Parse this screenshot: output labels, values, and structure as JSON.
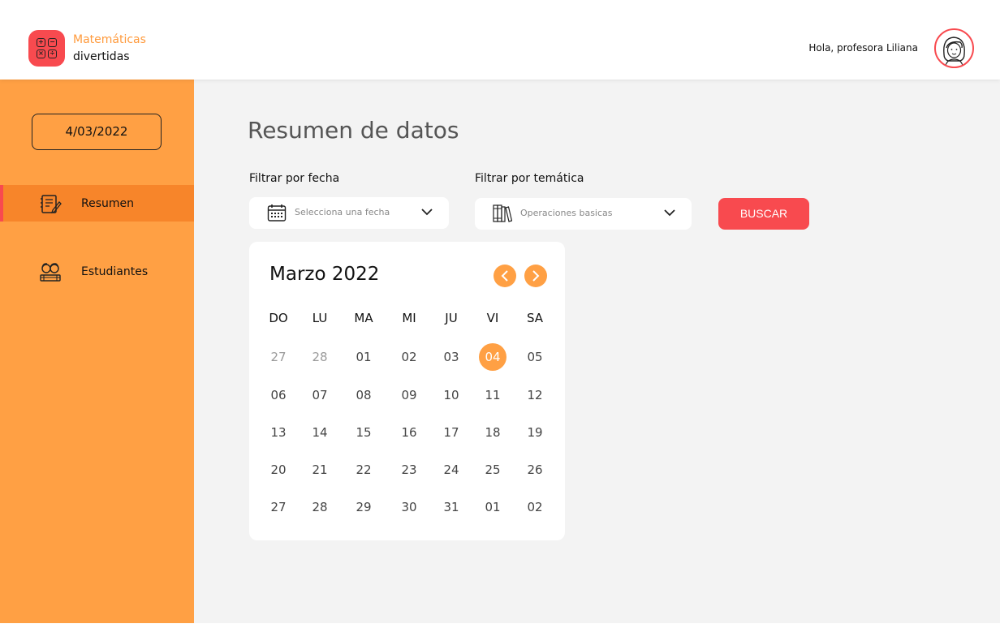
{
  "header": {
    "brand_line1": "Matemáticas",
    "brand_line2": "divertidas",
    "greeting": "Hola, profesora Liliana",
    "logo_icon": "calculator-icon",
    "avatar_icon": "teacher-avatar"
  },
  "sidebar": {
    "date": "4/03/2022",
    "items": [
      {
        "label": "Resumen",
        "icon": "notebook-pencil-icon",
        "active": true
      },
      {
        "label": "Estudiantes",
        "icon": "students-icon",
        "active": false
      }
    ]
  },
  "main": {
    "title": "Resumen de datos",
    "date_filter": {
      "label": "Filtrar por fecha",
      "placeholder": "Selecciona una fecha",
      "icon": "calendar-icon"
    },
    "topic_filter": {
      "label": "Filtrar por temática",
      "value": "Operaciones basicas",
      "icon": "books-icon"
    },
    "search_button": "BUSCAR"
  },
  "calendar": {
    "title": "Marzo 2022",
    "weekdays": [
      "DO",
      "LU",
      "MA",
      "MI",
      "JU",
      "VI",
      "SA"
    ],
    "weeks": [
      [
        "27",
        "28",
        "01",
        "02",
        "03",
        "04",
        "05"
      ],
      [
        "06",
        "07",
        "08",
        "09",
        "10",
        "11",
        "12"
      ],
      [
        "13",
        "14",
        "15",
        "16",
        "17",
        "18",
        "19"
      ],
      [
        "20",
        "21",
        "22",
        "23",
        "24",
        "25",
        "26"
      ],
      [
        "27",
        "28",
        "29",
        "30",
        "31",
        "01",
        "02"
      ]
    ],
    "muted_first_week_indices": [
      0,
      1
    ],
    "selected": "04"
  },
  "colors": {
    "accent_orange": "#ffa044",
    "active_orange": "#f7852a",
    "accent_red": "#f84a4f",
    "background": "#f3f3f3"
  }
}
